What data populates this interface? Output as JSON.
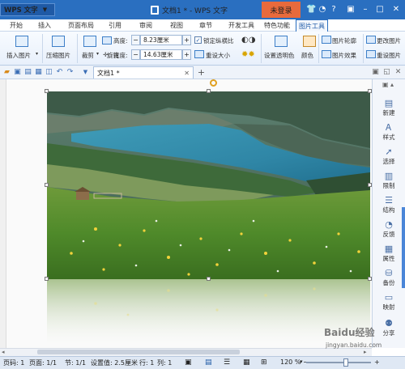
{
  "titlebar": {
    "app_name": "WPS 文字",
    "doc_title": "文档1 * - WPS 文字",
    "login": "未登录"
  },
  "tabs": [
    "开始",
    "插入",
    "页面布局",
    "引用",
    "审阅",
    "视图",
    "章节",
    "开发工具",
    "特色功能",
    "图片工具"
  ],
  "ribbon": {
    "insert_picture": "插入图片",
    "compress_picture": "压缩图片",
    "crop": "裁剪",
    "rotate": "旋转",
    "height_label": "高度:",
    "height_value": "8.23厘米",
    "width_label": "宽度:",
    "width_value": "14.63厘米",
    "lock_ratio": "锁定纵横比",
    "reset_size": "重设大小",
    "set_transparent": "设置透明色",
    "color": "颜色",
    "picture_outline": "图片轮廓",
    "picture_effect": "图片效果",
    "change_picture": "更改图片",
    "reset_picture": "重设图片"
  },
  "doc_tab": {
    "label": "文档1 *"
  },
  "sidebar": [
    {
      "icon": "new-icon",
      "label": "新建"
    },
    {
      "icon": "style-icon",
      "label": "样式"
    },
    {
      "icon": "select-icon",
      "label": "选择"
    },
    {
      "icon": "restrict-icon",
      "label": "限制"
    },
    {
      "icon": "structure-icon",
      "label": "结构"
    },
    {
      "icon": "feedback-icon",
      "label": "反馈"
    },
    {
      "icon": "properties-icon",
      "label": "属性"
    },
    {
      "icon": "backup-icon",
      "label": "备份"
    },
    {
      "icon": "slideshow-icon",
      "label": "映射"
    },
    {
      "icon": "share-icon",
      "label": "分享"
    }
  ],
  "status": {
    "page_num": "页码: 1",
    "page": "页面: 1/1",
    "section": "节: 1/1",
    "setting": "设置值: 2.5厘米",
    "line": "行: 1",
    "column": "列: 1",
    "zoom": "120 %"
  },
  "watermark": {
    "brand": "Baidu经验",
    "url": "jingyan.baidu.com"
  },
  "colors": {
    "titlebar": "#2a6fc0",
    "login": "#e86a3c",
    "accent": "#1f5aa6"
  }
}
